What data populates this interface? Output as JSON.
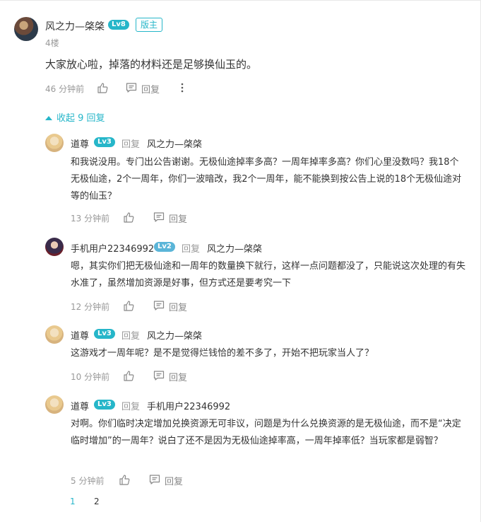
{
  "post": {
    "author": "风之力—棨棨",
    "level": "Lv8",
    "admin_badge": "版主",
    "floor": "4楼",
    "content": "大家放心啦，掉落的材料还是足够换仙玉的。",
    "time": "46 分钟前",
    "reply_label": "回复"
  },
  "collapse_label": "收起 9 回复",
  "replies": [
    {
      "author": "道尊",
      "level": "Lv3",
      "reply_word": "回复",
      "target": "风之力—棨棨",
      "content": "和我说没用。专门出公告谢谢。无极仙途掉率多高？一周年掉率多高？你们心里没数吗？我18个无极仙途，2个一周年，你们一波暗改，我2个一周年，能不能换到按公告上说的18个无极仙途对等的仙玉？",
      "time": "13 分钟前",
      "reply_label": "回复"
    },
    {
      "author": "手机用户22346992",
      "level": "Lv2",
      "reply_word": "回复",
      "target": "风之力—棨棨",
      "content": "嗯，其实你们把无极仙途和一周年的数量换下就行，这样一点问题都没了，只能说这次处理的有失水准了，虽然增加资源是好事，但方式还是要考究一下",
      "time": "12 分钟前",
      "reply_label": "回复"
    },
    {
      "author": "道尊",
      "level": "Lv3",
      "reply_word": "回复",
      "target": "风之力—棨棨",
      "content": "这游戏才一周年呢？是不是觉得烂钱恰的差不多了，开始不把玩家当人了？",
      "time": "10 分钟前",
      "reply_label": "回复"
    },
    {
      "author": "道尊",
      "level": "Lv3",
      "reply_word": "回复",
      "target": "手机用户22346992",
      "content": "对啊。你们临时决定增加兑换资源无可非议，问题是为什么兑换资源的是无极仙途，而不是“决定临时增加”的一周年？说白了还不是因为无极仙途掉率高，一周年掉率低？当玩家都是弱智？",
      "time": "5 分钟前",
      "reply_label": "回复"
    }
  ],
  "pagination": {
    "pages": [
      "1",
      "2"
    ],
    "current": "1"
  },
  "colors": {
    "accent": "#26b6c9",
    "muted": "#999999",
    "text": "#333333"
  }
}
